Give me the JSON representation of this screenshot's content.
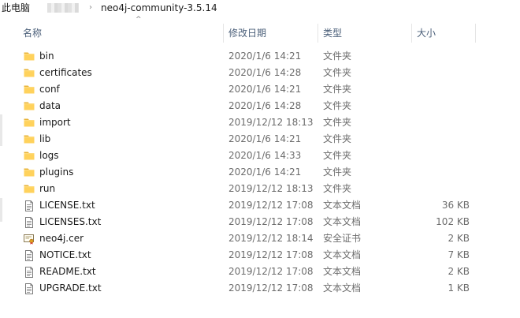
{
  "breadcrumb": {
    "root": "此电脑",
    "separator": "›",
    "current": "neo4j-community-3.5.14"
  },
  "columns": {
    "name": "名称",
    "date": "修改日期",
    "type": "类型",
    "size": "大小",
    "sort_indicator": "^"
  },
  "colors": {
    "header_text": "#4c607a",
    "folder_yellow": "#ffd25c",
    "secondary_text": "#6d6d6d"
  },
  "files": [
    {
      "name": "bin",
      "date": "2020/1/6 14:21",
      "type": "文件夹",
      "size": "",
      "icon": "folder-icon"
    },
    {
      "name": "certificates",
      "date": "2020/1/6 14:28",
      "type": "文件夹",
      "size": "",
      "icon": "folder-icon"
    },
    {
      "name": "conf",
      "date": "2020/1/6 14:21",
      "type": "文件夹",
      "size": "",
      "icon": "folder-icon"
    },
    {
      "name": "data",
      "date": "2020/1/6 14:28",
      "type": "文件夹",
      "size": "",
      "icon": "folder-icon"
    },
    {
      "name": "import",
      "date": "2019/12/12 18:13",
      "type": "文件夹",
      "size": "",
      "icon": "folder-icon"
    },
    {
      "name": "lib",
      "date": "2020/1/6 14:21",
      "type": "文件夹",
      "size": "",
      "icon": "folder-icon"
    },
    {
      "name": "logs",
      "date": "2020/1/6 14:33",
      "type": "文件夹",
      "size": "",
      "icon": "folder-icon"
    },
    {
      "name": "plugins",
      "date": "2020/1/6 14:21",
      "type": "文件夹",
      "size": "",
      "icon": "folder-icon"
    },
    {
      "name": "run",
      "date": "2019/12/12 18:13",
      "type": "文件夹",
      "size": "",
      "icon": "folder-icon"
    },
    {
      "name": "LICENSE.txt",
      "date": "2019/12/12 17:08",
      "type": "文本文档",
      "size": "36 KB",
      "icon": "text-file-icon"
    },
    {
      "name": "LICENSES.txt",
      "date": "2019/12/12 17:08",
      "type": "文本文档",
      "size": "102 KB",
      "icon": "text-file-icon"
    },
    {
      "name": "neo4j.cer",
      "date": "2019/12/12 18:14",
      "type": "安全证书",
      "size": "2 KB",
      "icon": "certificate-file-icon"
    },
    {
      "name": "NOTICE.txt",
      "date": "2019/12/12 17:08",
      "type": "文本文档",
      "size": "7 KB",
      "icon": "text-file-icon"
    },
    {
      "name": "README.txt",
      "date": "2019/12/12 17:08",
      "type": "文本文档",
      "size": "2 KB",
      "icon": "text-file-icon"
    },
    {
      "name": "UPGRADE.txt",
      "date": "2019/12/12 17:08",
      "type": "文本文档",
      "size": "1 KB",
      "icon": "text-file-icon"
    }
  ]
}
